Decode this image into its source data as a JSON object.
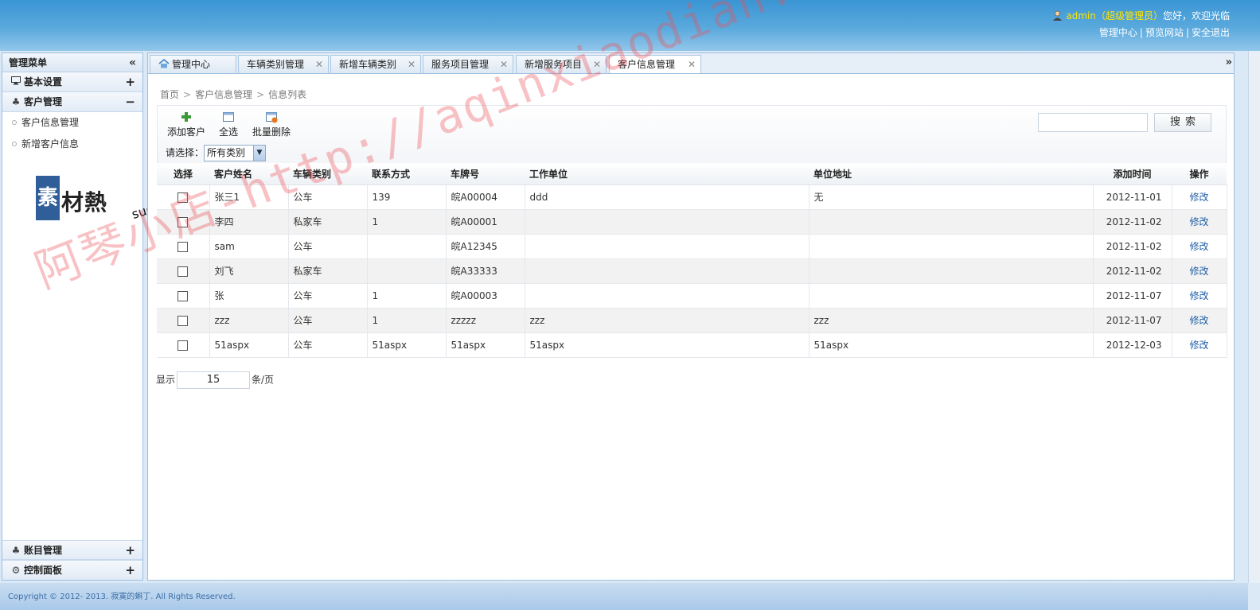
{
  "header": {
    "username": "admin",
    "role": "（超级管理员）",
    "greeting": "您好，欢迎光临",
    "links": [
      "管理中心",
      "预览网站",
      "安全退出"
    ]
  },
  "sidebar": {
    "title": "管理菜单",
    "collapse_icon": "«",
    "groups_top": [
      {
        "label": "基本设置",
        "icon": "monitor-icon",
        "toggle": "+"
      },
      {
        "label": "客户管理",
        "icon": "leaf-icon",
        "toggle": "−"
      }
    ],
    "items": [
      "客户信息管理",
      "新增客户信息"
    ],
    "groups_bottom": [
      {
        "label": "账目管理",
        "icon": "leaf-icon",
        "toggle": "+"
      },
      {
        "label": "控制面板",
        "icon": "gear-icon",
        "toggle": "+"
      }
    ],
    "logo": {
      "mark": "素",
      "word": "材熱",
      "url": "sucaire.com"
    }
  },
  "tabs": [
    {
      "label": "管理中心",
      "closable": false
    },
    {
      "label": "车辆类别管理",
      "closable": true
    },
    {
      "label": "新增车辆类别",
      "closable": true
    },
    {
      "label": "服务项目管理",
      "closable": true
    },
    {
      "label": "新增服务项目",
      "closable": true
    },
    {
      "label": "客户信息管理",
      "closable": true,
      "active": true
    }
  ],
  "tab_more_icon": "»",
  "breadcrumb": [
    "首页",
    "客户信息管理",
    "信息列表"
  ],
  "toolbar": {
    "add_label": "添加客户",
    "select_all_label": "全选",
    "batch_delete_label": "批量删除",
    "search_value": "",
    "search_label": "搜索",
    "filter_label": "请选择：",
    "filter_value": "所有类别"
  },
  "table": {
    "columns": [
      "选择",
      "客户姓名",
      "车辆类别",
      "联系方式",
      "车牌号",
      "工作单位",
      "单位地址",
      "添加时间",
      "操作"
    ],
    "rows": [
      {
        "name": "张三1",
        "type": "公车",
        "contact": "139",
        "plate": "皖A00004",
        "company": "ddd",
        "address": "无",
        "date": "2012-11-01",
        "action": "修改"
      },
      {
        "name": "李四",
        "type": "私家车",
        "contact": "1",
        "plate": "皖A00001",
        "company": "",
        "address": "",
        "date": "2012-11-02",
        "action": "修改"
      },
      {
        "name": "sam",
        "type": "公车",
        "contact": "",
        "plate": "皖A12345",
        "company": "",
        "address": "",
        "date": "2012-11-02",
        "action": "修改"
      },
      {
        "name": "刘飞",
        "type": "私家车",
        "contact": "",
        "plate": "皖A33333",
        "company": "",
        "address": "",
        "date": "2012-11-02",
        "action": "修改"
      },
      {
        "name": "张",
        "type": "公车",
        "contact": "1",
        "plate": "皖A00003",
        "company": "",
        "address": "",
        "date": "2012-11-07",
        "action": "修改"
      },
      {
        "name": "zzz",
        "type": "公车",
        "contact": "1",
        "plate": "zzzzz",
        "company": "zzz",
        "address": "zzz",
        "date": "2012-11-07",
        "action": "修改"
      },
      {
        "name": "51aspx",
        "type": "公车",
        "contact": "51aspx",
        "plate": "51aspx",
        "company": "51aspx",
        "address": "51aspx",
        "date": "2012-12-03",
        "action": "修改"
      }
    ]
  },
  "pager": {
    "prefix": "显示",
    "value": "15",
    "suffix": "条/页"
  },
  "footer": {
    "copyright": "Copyright © 2012- 2013. 寂寞的蝌丁. All Rights Reserved."
  },
  "watermark": "阿琴小店-http://aqinxiaodian.taobao.com"
}
